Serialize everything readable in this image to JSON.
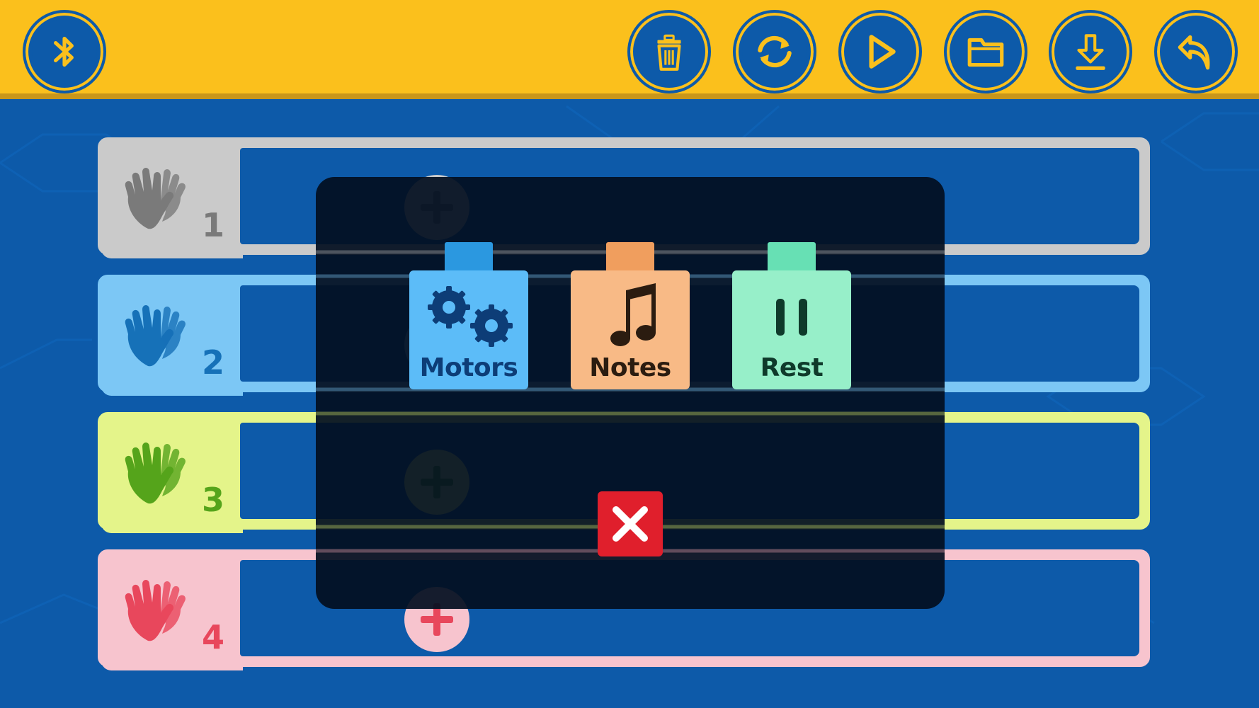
{
  "toolbar": {
    "left": [
      {
        "icon": "bluetooth-icon"
      }
    ],
    "right": [
      {
        "icon": "trash-icon"
      },
      {
        "icon": "refresh-icon"
      },
      {
        "icon": "play-icon"
      },
      {
        "icon": "folder-icon"
      },
      {
        "icon": "download-icon"
      },
      {
        "icon": "undo-icon"
      }
    ]
  },
  "lanes": [
    {
      "number": "1",
      "color": "#cacaca",
      "accent": "#7a7a7a",
      "hand_color": "#7a7a7a"
    },
    {
      "number": "2",
      "color": "#7cc7f5",
      "accent": "#1671b8",
      "hand_color": "#1671b8"
    },
    {
      "number": "3",
      "color": "#e4f48a",
      "accent": "#55a41b",
      "hand_color": "#55a41b"
    },
    {
      "number": "4",
      "color": "#f7c4ce",
      "accent": "#e8475c",
      "hand_color": "#e8475c"
    }
  ],
  "modal": {
    "blocks": [
      {
        "label": "Motors",
        "icon": "gears-icon",
        "color": "#5cbcf8"
      },
      {
        "label": "Notes",
        "icon": "music-note-icon",
        "color": "#f8ba86"
      },
      {
        "label": "Rest",
        "icon": "pause-icon",
        "color": "#97efc9"
      }
    ],
    "close_icon": "close-icon",
    "close_color": "#e01f2c"
  },
  "colors": {
    "topbar": "#fbc01c",
    "background": "#0d5aa9",
    "button": "#0d5aa9"
  }
}
